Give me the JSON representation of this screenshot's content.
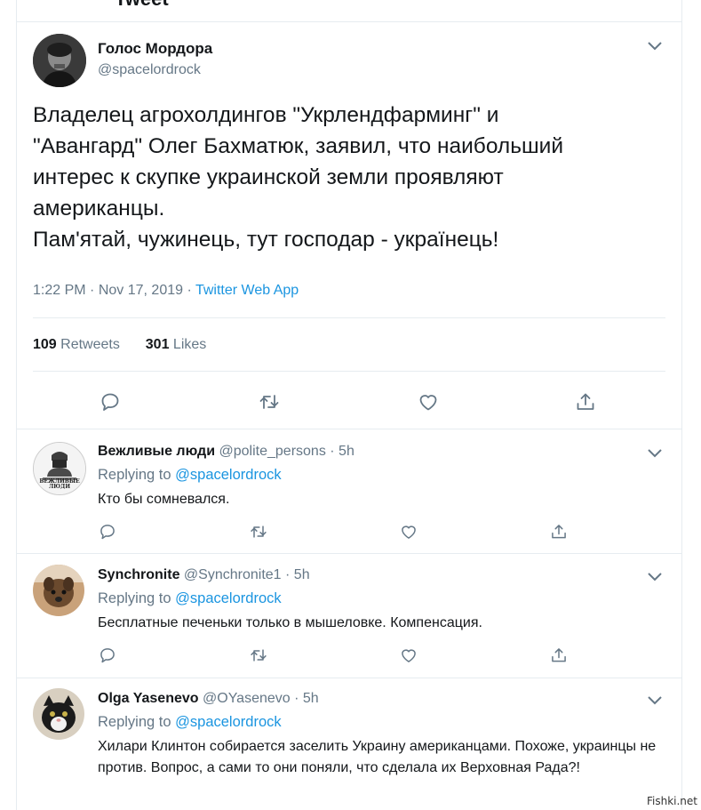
{
  "header_partial": "Tweet",
  "tweet": {
    "author_name": "Голос Мордора",
    "author_handle": "@spacelordrock",
    "text": "Владелец агрохолдингов \"Укрлендфарминг\" и\n\"Авангард\" Олег Бахматюк, заявил, что наибольший\nинтерес к скупке украинской земли проявляют\nамериканцы.\nПам'ятай, чужинець, тут господар - українець!",
    "time": "1:22 PM",
    "date": "Nov 17, 2019",
    "source": "Twitter Web App",
    "retweets_count": "109",
    "retweets_label": "Retweets",
    "likes_count": "301",
    "likes_label": "Likes"
  },
  "replies": [
    {
      "name": "Вежливые люди",
      "handle": "@polite_persons",
      "time": "5h",
      "replying_to_label": "Replying to",
      "replying_to_handle": "@spacelordrock",
      "text": "Кто бы сомневался.",
      "avatar_caption": "ВЕЖЛИВЫЕ ЛЮДИ"
    },
    {
      "name": "Synchronite",
      "handle": "@Synchronite1",
      "time": "5h",
      "replying_to_label": "Replying to",
      "replying_to_handle": "@spacelordrock",
      "text": "Бесплатные печеньки только в мышеловке. Компенсация."
    },
    {
      "name": "Olga Yasenevo",
      "handle": "@OYasenevo",
      "time": "5h",
      "replying_to_label": "Replying to",
      "replying_to_handle": "@spacelordrock",
      "text": "Хилари Клинтон собирается заселить Украину американцами. Похоже, украинцы не против. Вопрос, а сами то они поняли, что сделала их Верховная Рада?!"
    }
  ],
  "separator": "·",
  "icons": {
    "more": "chevron-down-icon",
    "reply": "reply-icon",
    "retweet": "retweet-icon",
    "like": "heart-icon",
    "share": "share-icon"
  },
  "watermark": "Fishki.net",
  "colors": {
    "link": "#1b95e0",
    "secondary_text": "#657786",
    "primary_text": "#14171a",
    "divider": "#e6ecf0"
  }
}
